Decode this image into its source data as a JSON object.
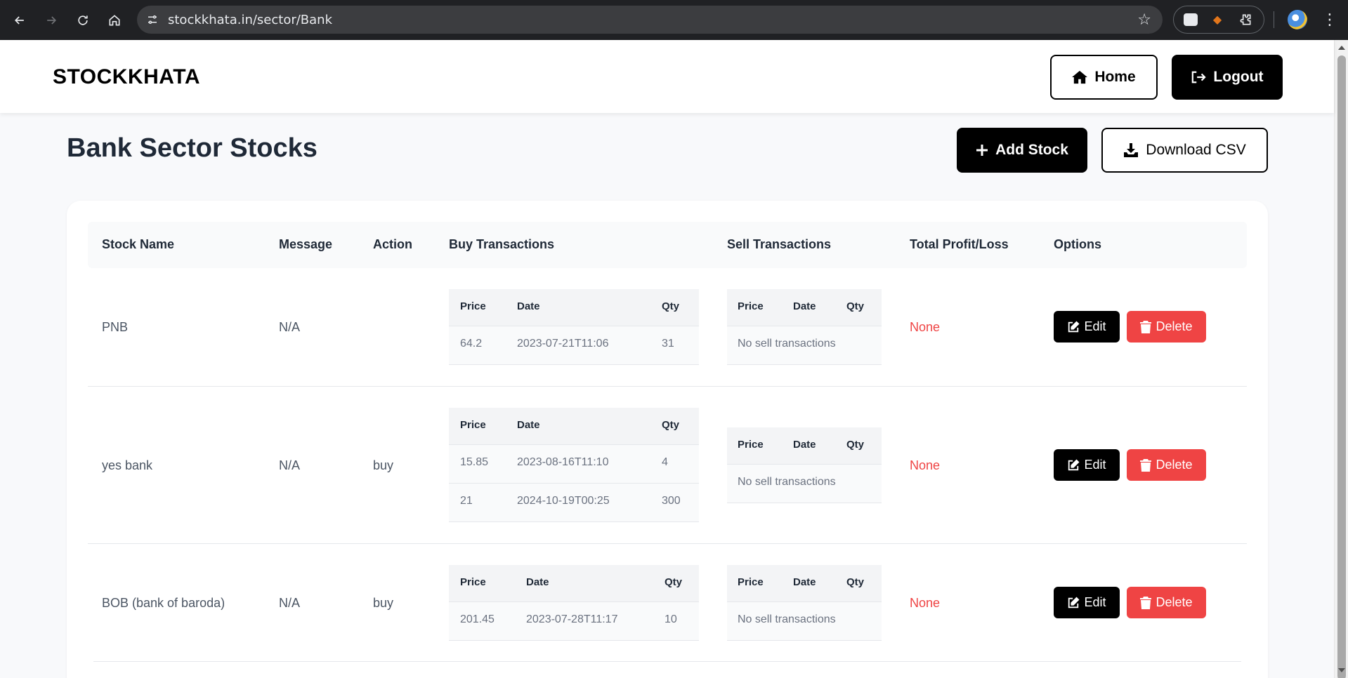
{
  "browser": {
    "url": "stockkhata.in/sector/Bank"
  },
  "header": {
    "brand": "STOCKKHATA",
    "home_label": "Home",
    "logout_label": "Logout"
  },
  "page": {
    "title": "Bank Sector Stocks",
    "add_label": "Add Stock",
    "csv_label": "Download CSV"
  },
  "table": {
    "headers": [
      "Stock Name",
      "Message",
      "Action",
      "Buy Transactions",
      "Sell Transactions",
      "Total Profit/Loss",
      "Options"
    ],
    "sub_headers": {
      "price": "Price",
      "date": "Date",
      "qty": "Qty"
    },
    "no_sell": "No sell transactions",
    "edit_label": "Edit",
    "delete_label": "Delete",
    "rows": [
      {
        "name": "PNB",
        "message": "N/A",
        "action": "",
        "profit": "None",
        "buys": [
          {
            "price": "64.2",
            "date": "2023-07-21T11:06",
            "qty": "31"
          }
        ]
      },
      {
        "name": "yes bank",
        "message": "N/A",
        "action": "buy",
        "profit": "None",
        "buys": [
          {
            "price": "15.85",
            "date": "2023-08-16T11:10",
            "qty": "4"
          },
          {
            "price": "21",
            "date": "2024-10-19T00:25",
            "qty": "300"
          }
        ]
      },
      {
        "name": "BOB (bank of baroda)",
        "message": "N/A",
        "action": "buy",
        "profit": "None",
        "buys": [
          {
            "price": "201.45",
            "date": "2023-07-28T11:17",
            "qty": "10"
          }
        ]
      }
    ]
  },
  "colors": {
    "accent_red": "#ef4444",
    "dark": "#000000"
  }
}
